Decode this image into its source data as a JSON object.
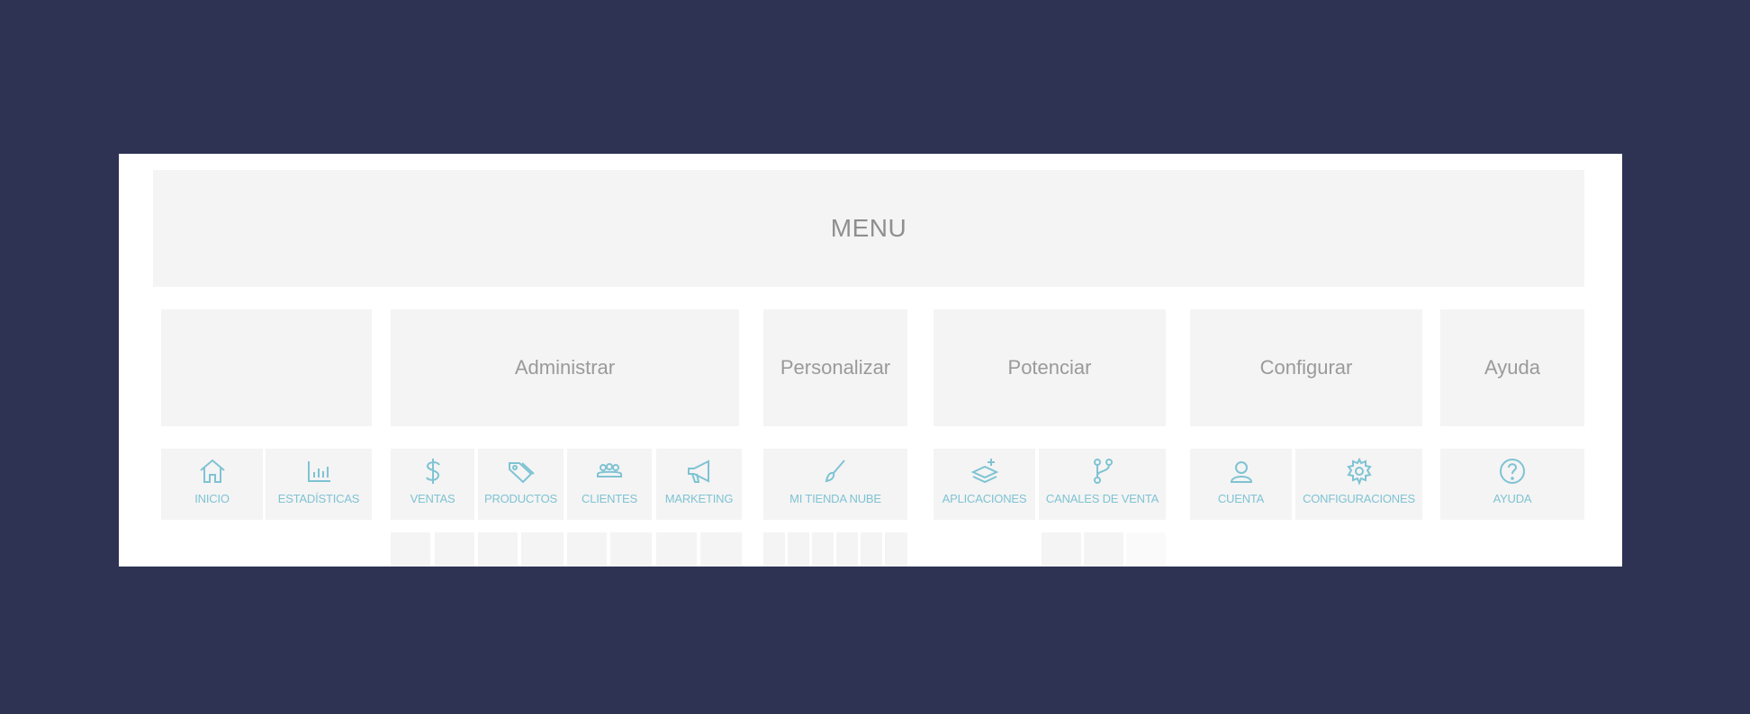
{
  "menu": {
    "title": "MENU"
  },
  "sections": {
    "administrar": "Administrar",
    "personalizar": "Personalizar",
    "potenciar": "Potenciar",
    "configurar": "Configurar",
    "ayuda": "Ayuda"
  },
  "items": {
    "inicio": {
      "label": "INICIO",
      "icon": "home-icon"
    },
    "estadisticas": {
      "label": "ESTADÍSTICAS",
      "icon": "bar-chart-icon"
    },
    "ventas": {
      "label": "VENTAS",
      "icon": "dollar-icon"
    },
    "productos": {
      "label": "PRODUCTOS",
      "icon": "tags-icon"
    },
    "clientes": {
      "label": "CLIENTES",
      "icon": "people-icon"
    },
    "marketing": {
      "label": "MARKETING",
      "icon": "megaphone-icon"
    },
    "mi_tienda_nube": {
      "label": "MI TIENDA NUBE",
      "icon": "brush-icon"
    },
    "aplicaciones": {
      "label": "APLICACIONES",
      "icon": "layers-plus-icon"
    },
    "canales_de_venta": {
      "label": "CANALES DE VENTA",
      "icon": "branch-icon"
    },
    "cuenta": {
      "label": "CUENTA",
      "icon": "user-icon"
    },
    "configuraciones": {
      "label": "CONFIGURACIONES",
      "icon": "gear-icon"
    },
    "ayuda": {
      "label": "AYUDA",
      "icon": "help-circle-icon"
    }
  },
  "colors": {
    "background": "#2e3354",
    "panel": "#f4f4f4",
    "accent": "#7fc3d3",
    "section_text": "#9a9a9a"
  }
}
